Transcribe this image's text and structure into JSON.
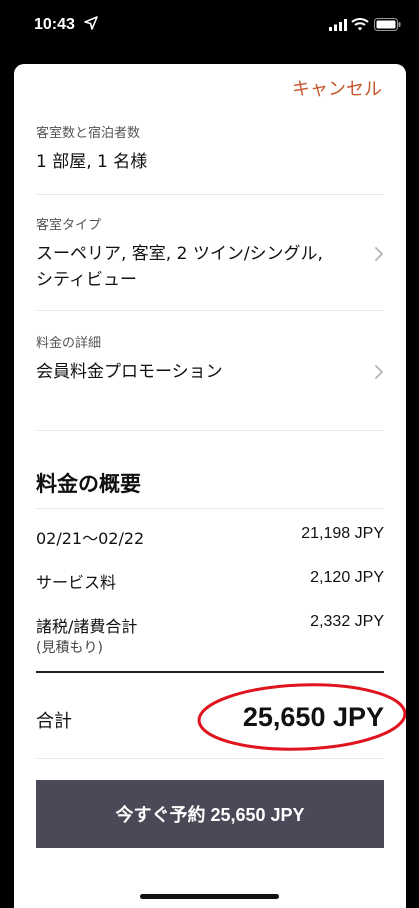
{
  "status_bar": {
    "time": "10:43",
    "icons": [
      "location-arrow-icon",
      "signal-icon",
      "wifi-icon",
      "battery-icon"
    ]
  },
  "header": {
    "cancel_label": "キャンセル"
  },
  "rooms_guests": {
    "label": "客室数と宿泊者数",
    "value": "1 部屋, 1 名様"
  },
  "room_type": {
    "label": "客室タイプ",
    "value_line1": "スーペリア, 客室, 2 ツイン/シングル,",
    "value_line2": "シティビュー"
  },
  "rate_details": {
    "label": "料金の詳細",
    "value": "会員料金プロモーション"
  },
  "summary": {
    "title": "料金の概要",
    "rows": [
      {
        "label": "02/21～02/22",
        "value": "21,198 JPY"
      },
      {
        "label": "サービス料",
        "value": "2,120 JPY"
      },
      {
        "label": "諸税/諸費合計",
        "sublabel": "(見積もり)",
        "value": "2,332 JPY"
      }
    ],
    "total_label": "合計",
    "total_value": "25,650 JPY"
  },
  "book_button": {
    "label": "今すぐ予約 25,650 JPY"
  },
  "colors": {
    "accent": "#c5562b",
    "button": "#4b4857",
    "highlight_ellipse": "#e0141e"
  }
}
